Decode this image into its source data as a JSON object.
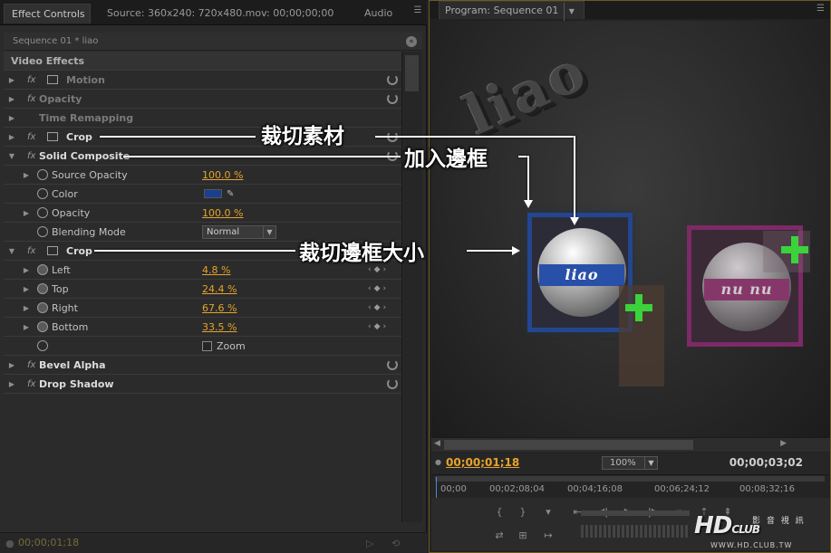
{
  "left_panel": {
    "tabs": [
      {
        "label": "Effect Controls"
      },
      {
        "label": "Source: 360x240: 720x480.mov: 00;00;00;00"
      },
      {
        "label": "Audio"
      }
    ],
    "sequence_label": "Sequence 01 * liao",
    "section_title": "Video Effects",
    "effects": {
      "motion": "Motion",
      "opacity": "Opacity",
      "time_remapping": "Time Remapping",
      "crop1": "Crop",
      "solid_composite": {
        "name": "Solid Composite",
        "source_opacity_label": "Source Opacity",
        "source_opacity_value": "100.0 %",
        "color_label": "Color",
        "color_value": "#1a3f8f",
        "opacity_label": "Opacity",
        "opacity_value": "100.0 %",
        "blending_label": "Blending Mode",
        "blending_value": "Normal"
      },
      "crop2": {
        "name": "Crop",
        "left_label": "Left",
        "left_value": "4.8 %",
        "top_label": "Top",
        "top_value": "24.4 %",
        "right_label": "Right",
        "right_value": "67.6 %",
        "bottom_label": "Bottom",
        "bottom_value": "33.5 %",
        "zoom_label": "Zoom"
      },
      "bevel_alpha": "Bevel Alpha",
      "drop_shadow": "Drop Shadow"
    },
    "fx_glyph": "fx",
    "bottom_timecode": "00;00;01;18"
  },
  "right_panel": {
    "tab_label": "Program: Sequence 01",
    "viewer": {
      "logo_text": "liao",
      "ball1_text": "liao",
      "ball2_text": "nu nu"
    },
    "timecode_current": "00;00;01;18",
    "timecode_duration": "00;00;03;02",
    "zoom": "100%",
    "ruler_labels": [
      "00;00",
      "00;02;08;04",
      "00;04;16;08",
      "00;06;24;12",
      "00;08;32;16"
    ]
  },
  "annotations": {
    "crop_material": "裁切素材",
    "add_border": "加入邊框",
    "crop_border_size": "裁切邊框大小"
  },
  "watermark": {
    "logo": "HD",
    "logo_small": "CLUB",
    "subtitle": "影 音 視 訊",
    "url": "WWW.HD.CLUB.TW"
  }
}
